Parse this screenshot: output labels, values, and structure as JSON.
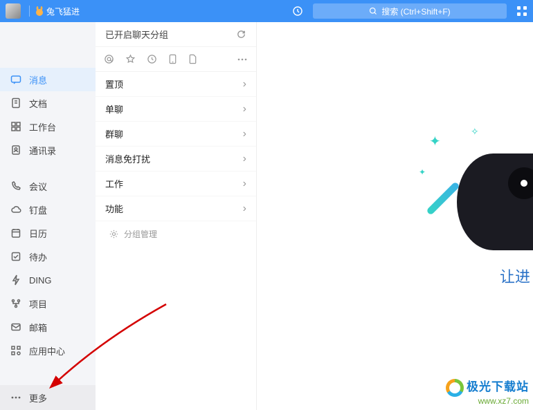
{
  "header": {
    "title": "兔飞猛进",
    "search_placeholder": "搜索 (Ctrl+Shift+F)"
  },
  "sidebar": {
    "items": [
      {
        "label": "消息"
      },
      {
        "label": "文档"
      },
      {
        "label": "工作台"
      },
      {
        "label": "通讯录"
      },
      {
        "label": "会议"
      },
      {
        "label": "钉盘"
      },
      {
        "label": "日历"
      },
      {
        "label": "待办"
      },
      {
        "label": "DING"
      },
      {
        "label": "项目"
      },
      {
        "label": "邮箱"
      },
      {
        "label": "应用中心"
      }
    ],
    "more_label": "更多"
  },
  "panel": {
    "header_text": "已开启聊天分组",
    "groups": [
      {
        "label": "置顶"
      },
      {
        "label": "单聊"
      },
      {
        "label": "群聊"
      },
      {
        "label": "消息免打扰"
      },
      {
        "label": "工作"
      },
      {
        "label": "功能"
      }
    ],
    "manage_label": "分组管理"
  },
  "content": {
    "promo_text": "让进"
  },
  "watermark": {
    "line1": "极光下载站",
    "line2": "www.xz7.com"
  }
}
